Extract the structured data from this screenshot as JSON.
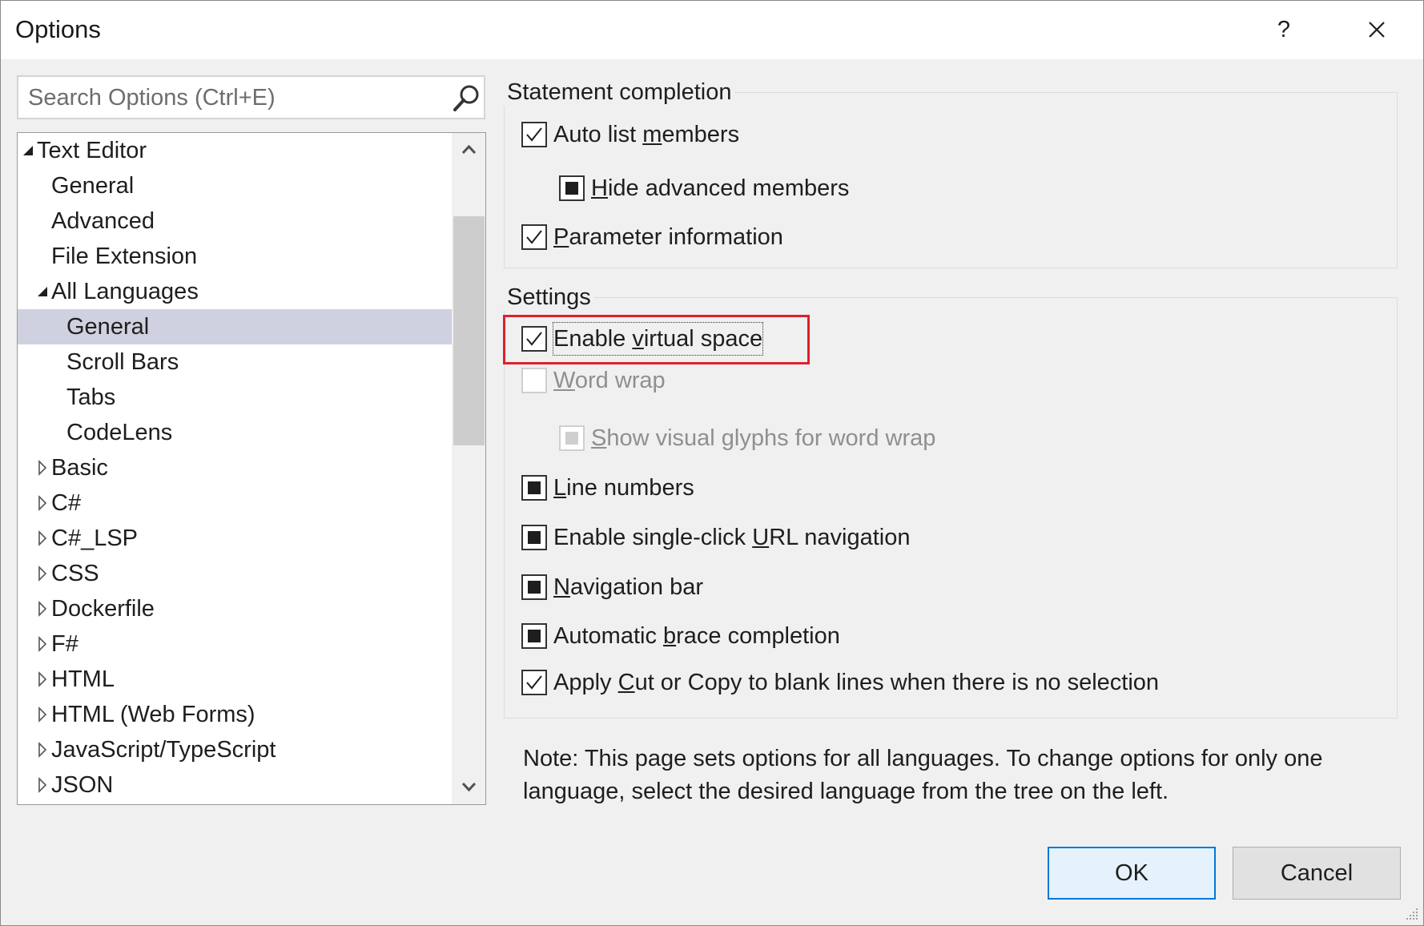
{
  "window": {
    "title": "Options",
    "help_label": "?",
    "close_icon": "close-icon"
  },
  "search": {
    "placeholder": "Search Options (Ctrl+E)",
    "icon": "search-icon"
  },
  "tree": {
    "items": [
      {
        "label": "Text Editor",
        "expanded": true,
        "level": 0
      },
      {
        "label": "General",
        "level": 1
      },
      {
        "label": "Advanced",
        "level": 1
      },
      {
        "label": "File Extension",
        "level": 1
      },
      {
        "label": "All Languages",
        "expanded": true,
        "level": 1
      },
      {
        "label": "General",
        "level": 2,
        "selected": true
      },
      {
        "label": "Scroll Bars",
        "level": 2
      },
      {
        "label": "Tabs",
        "level": 2
      },
      {
        "label": "CodeLens",
        "level": 2
      },
      {
        "label": "Basic",
        "expanded": false,
        "level": 1
      },
      {
        "label": "C#",
        "expanded": false,
        "level": 1
      },
      {
        "label": "C#_LSP",
        "expanded": false,
        "level": 1
      },
      {
        "label": "CSS",
        "expanded": false,
        "level": 1
      },
      {
        "label": "Dockerfile",
        "expanded": false,
        "level": 1
      },
      {
        "label": "F#",
        "expanded": false,
        "level": 1
      },
      {
        "label": "HTML",
        "expanded": false,
        "level": 1
      },
      {
        "label": "HTML (Web Forms)",
        "expanded": false,
        "level": 1
      },
      {
        "label": "JavaScript/TypeScript",
        "expanded": false,
        "level": 1
      },
      {
        "label": "JSON",
        "expanded": false,
        "level": 1
      }
    ]
  },
  "statement_completion": {
    "title": "Statement completion",
    "auto_list_members": {
      "pre": "Auto list ",
      "u": "m",
      "post": "embers",
      "state": "checked"
    },
    "hide_advanced_members": {
      "pre": "",
      "u": "H",
      "post": "ide advanced members",
      "state": "indeterminate"
    },
    "parameter_information": {
      "pre": "",
      "u": "P",
      "post": "arameter information",
      "state": "checked"
    }
  },
  "settings": {
    "title": "Settings",
    "enable_virtual_space": {
      "pre": "Enable ",
      "u": "v",
      "post": "irtual space",
      "state": "checked"
    },
    "word_wrap": {
      "pre": "",
      "u": "W",
      "post": "ord wrap",
      "state": "unchecked",
      "disabled": true
    },
    "show_visual_glyphs": {
      "pre": "",
      "u": "S",
      "post": "how visual glyphs for word wrap",
      "state": "indeterminate",
      "disabled": true
    },
    "line_numbers": {
      "pre": "",
      "u": "L",
      "post": "ine numbers",
      "state": "indeterminate"
    },
    "single_click_url": {
      "pre": "Enable single-click ",
      "u": "U",
      "post": "RL navigation",
      "state": "indeterminate"
    },
    "navigation_bar": {
      "pre": "",
      "u": "N",
      "post": "avigation bar",
      "state": "indeterminate"
    },
    "brace_completion": {
      "pre": "Automatic ",
      "u": "b",
      "post": "race completion",
      "state": "indeterminate"
    },
    "apply_cut_copy": {
      "pre": "Apply ",
      "u": "C",
      "post": "ut or Copy to blank lines when there is no selection",
      "state": "checked"
    }
  },
  "note": "Note: This page sets options for all languages. To change options for only one language, select the desired language from the tree on the left.",
  "buttons": {
    "ok": "OK",
    "cancel": "Cancel"
  },
  "colors": {
    "highlight": "#e0202a",
    "selected_row": "#cfd1e0",
    "default_button_border": "#0078d7"
  }
}
